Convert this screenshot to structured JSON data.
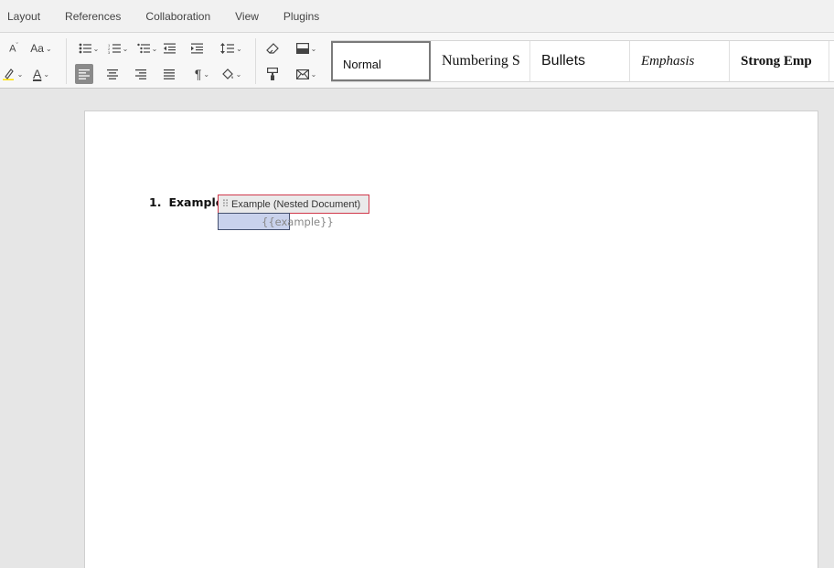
{
  "menu": [
    "Layout",
    "References",
    "Collaboration",
    "View",
    "Plugins"
  ],
  "toolbar": {
    "font_size_label": "A",
    "change_case_label": "Aa",
    "font_color_label": "A",
    "highlight_color": "#ffe100",
    "font_color": "#000000",
    "paragraph_mark": "¶"
  },
  "styles": [
    "Normal",
    "Numbering S",
    "Bullets",
    "Emphasis",
    "Strong Emp"
  ],
  "document": {
    "list_number": "1.",
    "list_text": "Example.",
    "nested_doc_label": "Example (Nested Document)",
    "placeholder": "{{example}}"
  }
}
